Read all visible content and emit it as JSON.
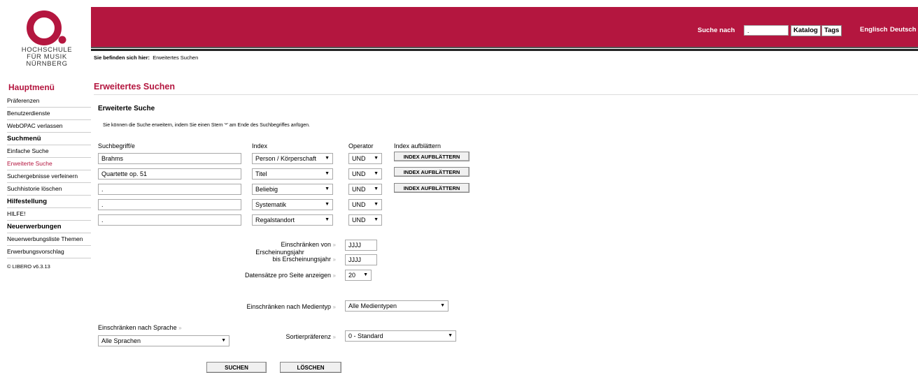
{
  "logo": {
    "line1": "HOCHSCHULE",
    "line2": "FÜR MUSIK",
    "line3": "NÜRNBERG",
    "brand_color": "#b4163f"
  },
  "header": {
    "search_label": "Suche nach",
    "search_value": ".",
    "katalog_label": "Katalog",
    "tags_label": "Tags",
    "lang_en": "Englisch",
    "lang_de": "Deutsch"
  },
  "breadcrumb": {
    "prefix": "Sie befinden sich hier:",
    "current": "Erweitertes Suchen"
  },
  "sidebar": {
    "title": "Hauptmenü",
    "items": [
      {
        "label": "Präferenzen",
        "type": "link"
      },
      {
        "label": "Benutzerdienste",
        "type": "link"
      },
      {
        "label": "WebOPAC verlassen",
        "type": "link"
      },
      {
        "label": "Suchmenü",
        "type": "header"
      },
      {
        "label": "Einfache Suche",
        "type": "link"
      },
      {
        "label": "Erweiterte Suche",
        "type": "active"
      },
      {
        "label": "Suchergebnisse verfeinern",
        "type": "link"
      },
      {
        "label": "Suchhistorie löschen",
        "type": "link"
      },
      {
        "label": "Hilfestellung",
        "type": "header"
      },
      {
        "label": "HILFE!",
        "type": "link"
      },
      {
        "label": "Neuerwerbungen",
        "type": "header"
      },
      {
        "label": "Neuerwerbungsliste Themen",
        "type": "link"
      },
      {
        "label": "Erwerbungsvorschlag",
        "type": "link"
      }
    ],
    "footer": "© LIBERO v6.3.13"
  },
  "main": {
    "title": "Erweitertes Suchen",
    "subtitle": "Erweiterte Suche",
    "hint": "Sie können die Suche erweitern, indem Sie einen Stern '*' am Ende des Suchbegriffes anfügen.",
    "columns": {
      "terms": "Suchbegriff/e",
      "index": "Index",
      "operator": "Operator",
      "browse": "Index aufblättern"
    },
    "rows": [
      {
        "term": "Brahms",
        "index": "Person / Körperschaft",
        "operator": "UND",
        "browse": "INDEX AUFBLÄTTERN"
      },
      {
        "term": "Quartette op. 51",
        "index": "Titel",
        "operator": "UND",
        "browse": "INDEX AUFBLÄTTERN"
      },
      {
        "term": ".",
        "index": "Beliebig",
        "operator": "UND",
        "browse": "INDEX AUFBLÄTTERN"
      },
      {
        "term": ".",
        "index": "Systematik",
        "operator": "UND",
        "browse": ""
      },
      {
        "term": ".",
        "index": "Regalstandort",
        "operator": "UND",
        "browse": ""
      }
    ],
    "year_from_label": "Einschränken von",
    "year_mid_label": "Erscheinungsjahr",
    "year_to_label": "bis Erscheinungsjahr",
    "year_from_value": "JJJJ",
    "year_to_value": "JJJJ",
    "per_page_label": "Datensätze pro Seite anzeigen",
    "per_page_value": "20",
    "media_label": "Einschränken nach Medientyp",
    "media_value": "Alle Medientypen",
    "lang_label": "Einschränken nach Sprache",
    "lang_value": "Alle Sprachen",
    "sort_label": "Sortierpräferenz",
    "sort_value": "0 - Standard",
    "search_button": "SUCHEN",
    "clear_button": "LÖSCHEN",
    "arrow_glyph": "»"
  }
}
